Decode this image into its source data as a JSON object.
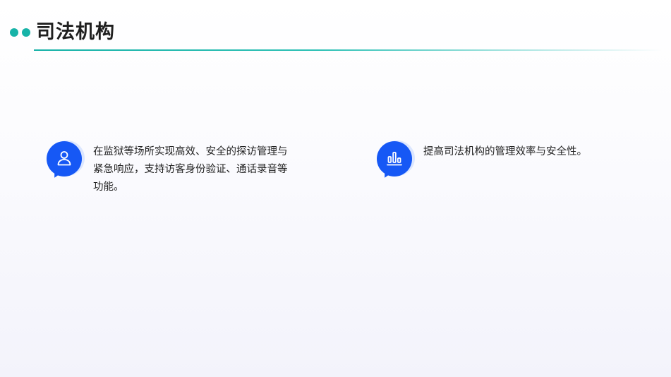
{
  "slide": {
    "title": "司法机构",
    "accent_color": "#17b3a8",
    "icon_color": "#1658f5"
  },
  "items": [
    {
      "icon": "user-icon",
      "text": "在监狱等场所实现高效、安全的探访管理与紧急响应，支持访客身份验证、通话录音等功能。"
    },
    {
      "icon": "bar-chart-icon",
      "text": "提高司法机构的管理效率与安全性。"
    }
  ]
}
